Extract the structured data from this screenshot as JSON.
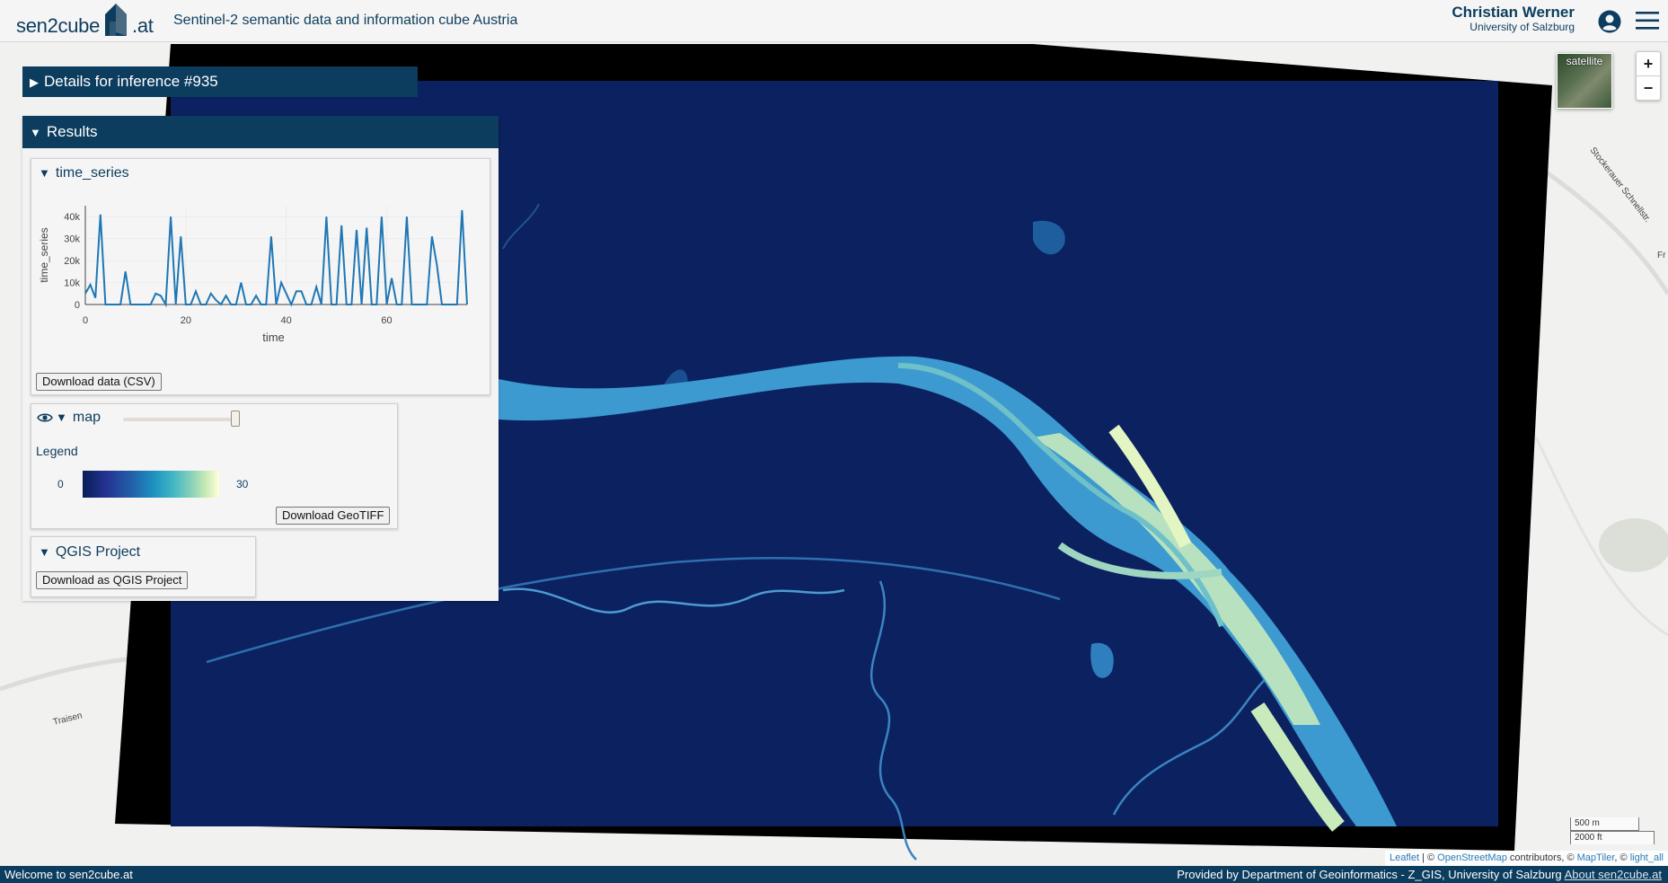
{
  "header": {
    "logo_left": "sen2cube",
    "logo_right": ".at",
    "title": "Sentinel-2 semantic data and information cube Austria",
    "user_name": "Christian Werner",
    "user_org": "University of Salzburg"
  },
  "details_panel": {
    "title": "Details for inference #935"
  },
  "results_panel": {
    "title": "Results",
    "time_series": {
      "title": "time_series",
      "download_label": "Download data (CSV)"
    },
    "map_card": {
      "title": "map",
      "opacity": 0.95,
      "legend_label": "Legend",
      "legend_min": "0",
      "legend_max": "30",
      "download_label": "Download GeoTIFF"
    },
    "qgis": {
      "title": "QGIS Project",
      "download_label": "Download as QGIS Project"
    }
  },
  "chart_data": {
    "type": "line",
    "xlabel": "time",
    "ylabel": "time_series",
    "xlim": [
      0,
      76
    ],
    "ylim": [
      0,
      45000
    ],
    "xticks": [
      "0",
      "20",
      "40",
      "60"
    ],
    "yticks": [
      "0",
      "10k",
      "20k",
      "30k",
      "40k"
    ],
    "xtick_values": [
      0,
      20,
      40,
      60
    ],
    "ytick_values": [
      0,
      10000,
      20000,
      30000,
      40000
    ],
    "series": [
      {
        "values": [
          5000,
          9000,
          3000,
          41000,
          0,
          0,
          0,
          0,
          15000,
          0,
          0,
          0,
          0,
          0,
          5000,
          4000,
          0,
          40000,
          0,
          31000,
          0,
          0,
          6000,
          0,
          0,
          5000,
          2000,
          0,
          4000,
          0,
          0,
          10000,
          0,
          0,
          4000,
          0,
          0,
          31000,
          0,
          10000,
          5000,
          0,
          6000,
          6000,
          0,
          0,
          8000,
          0,
          40000,
          0,
          0,
          36000,
          0,
          0,
          34000,
          0,
          35000,
          0,
          0,
          40000,
          0,
          12000,
          0,
          0,
          40000,
          0,
          0,
          0,
          0,
          31000,
          18000,
          0,
          0,
          0,
          0,
          43000,
          0
        ]
      }
    ]
  },
  "map": {
    "layer_button": "satellite",
    "zoom_in": "+",
    "zoom_out": "−",
    "scale_metric": "500 m",
    "scale_imperial": "2000 ft",
    "attr_leaflet": "Leaflet",
    "attr_sep1": " | © ",
    "attr_osm": "OpenStreetMap",
    "attr_mid": " contributors, © ",
    "attr_maptiler": "MapTiler",
    "attr_sep2": ", © ",
    "attr_light": "light_all",
    "streets": [
      "Stockerauer Schnellstr.",
      "Traisen",
      "Fr"
    ]
  },
  "footer": {
    "left": "Welcome to sen2cube.at",
    "right": "Provided by Department of Geoinformatics - Z_GIS, University of Salzburg",
    "link": "About sen2cube.at"
  },
  "colors": {
    "navy": "#0c3c5e",
    "raster_bg": "#0b2160",
    "water_low": "#3a8fc4",
    "water_high": "#e3f4c0"
  }
}
